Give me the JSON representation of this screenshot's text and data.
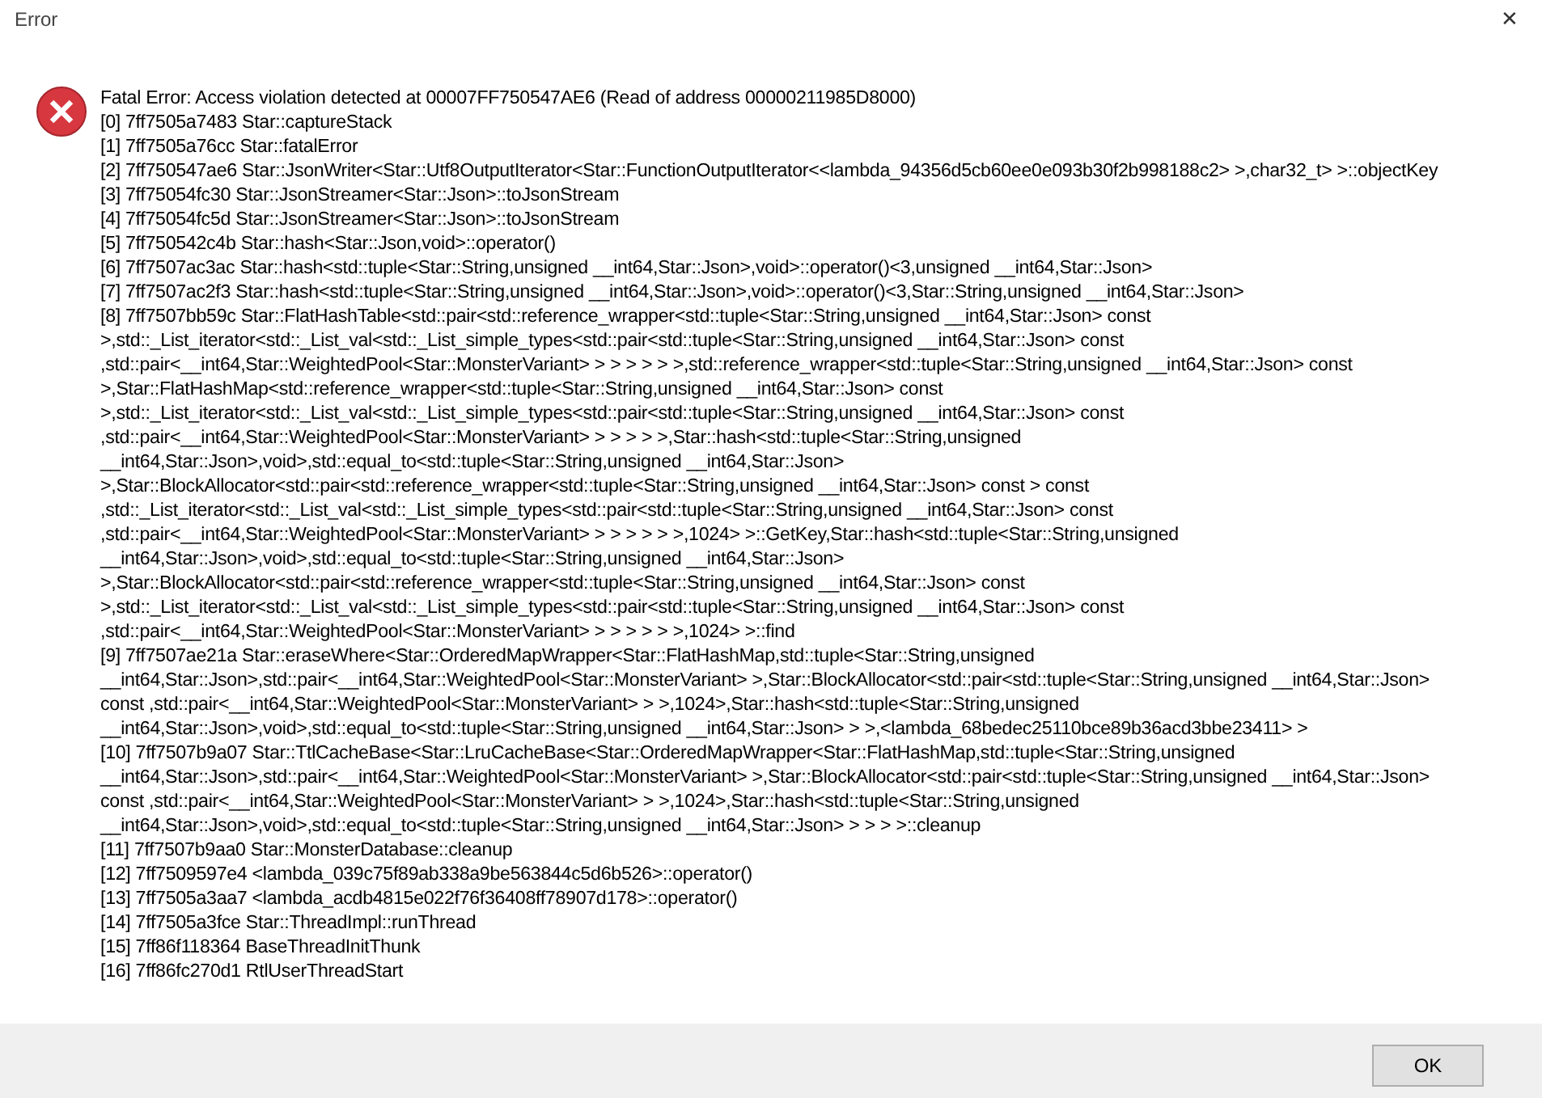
{
  "window": {
    "title": "Error",
    "close": "✕"
  },
  "message": [
    "Fatal Error: Access violation detected at 00007FF750547AE6 (Read of address 00000211985D8000)",
    "[0] 7ff7505a7483 Star::captureStack",
    "[1] 7ff7505a76cc Star::fatalError",
    "[2] 7ff750547ae6 Star::JsonWriter<Star::Utf8OutputIterator<Star::FunctionOutputIterator<<lambda_94356d5cb60ee0e093b30f2b998188c2> >,char32_t> >::objectKey",
    "[3] 7ff75054fc30 Star::JsonStreamer<Star::Json>::toJsonStream",
    "[4] 7ff75054fc5d Star::JsonStreamer<Star::Json>::toJsonStream",
    "[5] 7ff750542c4b Star::hash<Star::Json,void>::operator()",
    "[6] 7ff7507ac3ac Star::hash<std::tuple<Star::String,unsigned __int64,Star::Json>,void>::operator()<3,unsigned __int64,Star::Json>",
    "[7] 7ff7507ac2f3 Star::hash<std::tuple<Star::String,unsigned __int64,Star::Json>,void>::operator()<3,Star::String,unsigned __int64,Star::Json>",
    "[8] 7ff7507bb59c Star::FlatHashTable<std::pair<std::reference_wrapper<std::tuple<Star::String,unsigned __int64,Star::Json> const",
    ">,std::_List_iterator<std::_List_val<std::_List_simple_types<std::pair<std::tuple<Star::String,unsigned __int64,Star::Json> const",
    ",std::pair<__int64,Star::WeightedPool<Star::MonsterVariant> > > > > > >,std::reference_wrapper<std::tuple<Star::String,unsigned __int64,Star::Json> const",
    ">,Star::FlatHashMap<std::reference_wrapper<std::tuple<Star::String,unsigned __int64,Star::Json> const",
    ">,std::_List_iterator<std::_List_val<std::_List_simple_types<std::pair<std::tuple<Star::String,unsigned __int64,Star::Json> const",
    ",std::pair<__int64,Star::WeightedPool<Star::MonsterVariant> > > > > >,Star::hash<std::tuple<Star::String,unsigned",
    "__int64,Star::Json>,void>,std::equal_to<std::tuple<Star::String,unsigned __int64,Star::Json>",
    ">,Star::BlockAllocator<std::pair<std::reference_wrapper<std::tuple<Star::String,unsigned __int64,Star::Json> const > const",
    ",std::_List_iterator<std::_List_val<std::_List_simple_types<std::pair<std::tuple<Star::String,unsigned __int64,Star::Json> const",
    ",std::pair<__int64,Star::WeightedPool<Star::MonsterVariant> > > > > > >,1024> >::GetKey,Star::hash<std::tuple<Star::String,unsigned",
    "__int64,Star::Json>,void>,std::equal_to<std::tuple<Star::String,unsigned __int64,Star::Json>",
    ">,Star::BlockAllocator<std::pair<std::reference_wrapper<std::tuple<Star::String,unsigned __int64,Star::Json> const",
    ">,std::_List_iterator<std::_List_val<std::_List_simple_types<std::pair<std::tuple<Star::String,unsigned __int64,Star::Json> const",
    ",std::pair<__int64,Star::WeightedPool<Star::MonsterVariant> > > > > > >,1024> >::find",
    "[9] 7ff7507ae21a Star::eraseWhere<Star::OrderedMapWrapper<Star::FlatHashMap,std::tuple<Star::String,unsigned",
    "__int64,Star::Json>,std::pair<__int64,Star::WeightedPool<Star::MonsterVariant> >,Star::BlockAllocator<std::pair<std::tuple<Star::String,unsigned __int64,Star::Json>",
    "const ,std::pair<__int64,Star::WeightedPool<Star::MonsterVariant> > >,1024>,Star::hash<std::tuple<Star::String,unsigned",
    "__int64,Star::Json>,void>,std::equal_to<std::tuple<Star::String,unsigned __int64,Star::Json> > >,<lambda_68bedec25110bce89b36acd3bbe23411> >",
    "[10] 7ff7507b9a07 Star::TtlCacheBase<Star::LruCacheBase<Star::OrderedMapWrapper<Star::FlatHashMap,std::tuple<Star::String,unsigned",
    "__int64,Star::Json>,std::pair<__int64,Star::WeightedPool<Star::MonsterVariant> >,Star::BlockAllocator<std::pair<std::tuple<Star::String,unsigned __int64,Star::Json>",
    "const ,std::pair<__int64,Star::WeightedPool<Star::MonsterVariant> > >,1024>,Star::hash<std::tuple<Star::String,unsigned",
    "__int64,Star::Json>,void>,std::equal_to<std::tuple<Star::String,unsigned __int64,Star::Json> > > > >::cleanup",
    "[11] 7ff7507b9aa0 Star::MonsterDatabase::cleanup",
    "[12] 7ff7509597e4 <lambda_039c75f89ab338a9be563844c5d6b526>::operator()",
    "[13] 7ff7505a3aa7 <lambda_acdb4815e022f76f36408ff78907d178>::operator()",
    "[14] 7ff7505a3fce Star::ThreadImpl::runThread",
    "[15] 7ff86f118364 BaseThreadInitThunk",
    "[16] 7ff86fc270d1 RtlUserThreadStart"
  ],
  "buttons": [
    "OK"
  ]
}
